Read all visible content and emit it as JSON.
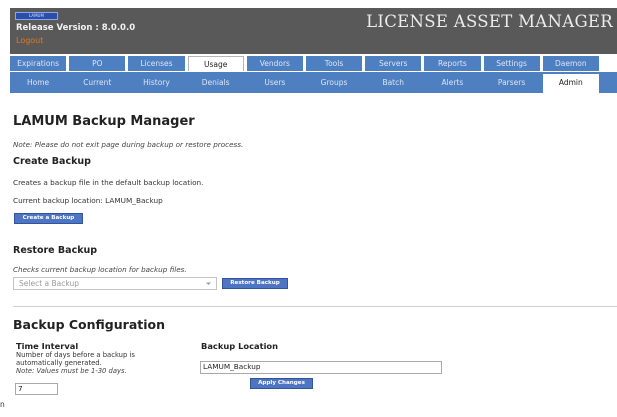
{
  "header": {
    "logo_text": "LAMUM",
    "release": "Release Version : 8.0.0.0",
    "logout": "Logout",
    "app_title": "LICENSE ASSET MANAGER"
  },
  "nav": {
    "main_tabs": [
      "Expirations",
      "PO",
      "Licenses",
      "Usage",
      "Vendors",
      "Tools",
      "Servers",
      "Reports",
      "Settings",
      "Daemon"
    ],
    "sub_tabs": [
      "Home",
      "Current",
      "History",
      "Denials",
      "Users",
      "Groups",
      "Batch",
      "Alerts",
      "Parsers",
      "Admin"
    ]
  },
  "page": {
    "title": "LAMUM Backup Manager",
    "note": "Note: Please do not exit page during backup or restore process."
  },
  "create": {
    "heading": "Create Backup",
    "description": "Creates a backup file in the default backup location.",
    "current_location": "Current backup location: LAMUM_Backup",
    "button": "Create a Backup"
  },
  "restore": {
    "heading": "Restore Backup",
    "note": "Checks current backup location for backup files.",
    "select_placeholder": "Select a Backup",
    "button": "Restore Backup"
  },
  "config": {
    "heading": "Backup Configuration",
    "interval_heading": "Time Interval",
    "interval_line1": "Number of days before a backup is",
    "interval_line2": "automatically generated.",
    "interval_note": "Note: Values must be 1-30 days.",
    "interval_value": "7",
    "location_heading": "Backup Location",
    "location_value": "LAMUM_Backup",
    "apply_button": "Apply Changes"
  },
  "truncated_text": "n"
}
